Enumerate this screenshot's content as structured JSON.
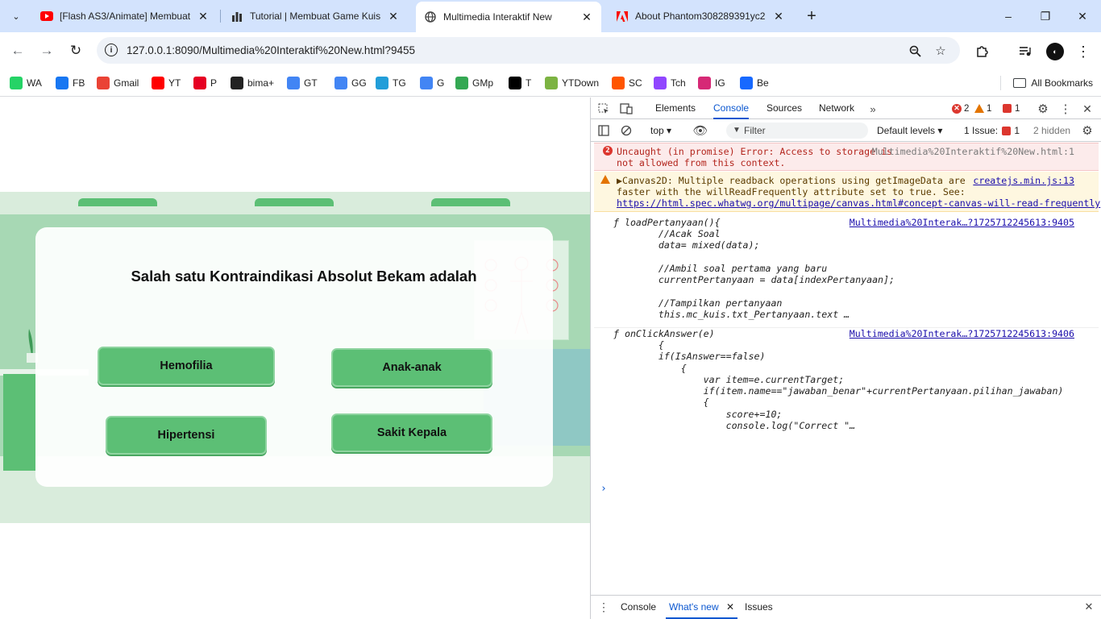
{
  "browser": {
    "tabs": [
      {
        "title": "[Flash AS3/Animate] Membuat",
        "favicon": "youtube-icon",
        "active": false
      },
      {
        "title": "Tutorial | Membuat Game Kuis",
        "favicon": "chart-icon",
        "active": false
      },
      {
        "title": "Multimedia Interaktif New",
        "favicon": "globe-icon",
        "active": true
      },
      {
        "title": "About Phantom308289391yc2",
        "favicon": "adobe-icon",
        "active": false
      }
    ],
    "new_tab": "+",
    "window_controls": [
      "–",
      "❐",
      "✕"
    ],
    "url": "127.0.0.1:8090/Multimedia%20Interaktif%20New.html?9455",
    "bookmarks": [
      {
        "label": "WA",
        "icon": "whatsapp-icon",
        "color": "#25d366"
      },
      {
        "label": "FB",
        "icon": "facebook-icon",
        "color": "#1877f2"
      },
      {
        "label": "Gmail",
        "icon": "gmail-icon",
        "color": "#ea4335"
      },
      {
        "label": "YT",
        "icon": "youtube-icon",
        "color": "#ff0000"
      },
      {
        "label": "P",
        "icon": "pinterest-icon",
        "color": "#e60023"
      },
      {
        "label": "bima+",
        "icon": "bima-icon",
        "color": "#222222"
      },
      {
        "label": "GT",
        "icon": "google-translate-icon",
        "color": "#4285f4"
      },
      {
        "label": "GG",
        "icon": "google-icon",
        "color": "#4285f4"
      },
      {
        "label": "TG",
        "icon": "telegram-icon",
        "color": "#229ed9"
      },
      {
        "label": "G",
        "icon": "google-icon",
        "color": "#4285f4"
      },
      {
        "label": "GMp",
        "icon": "google-maps-icon",
        "color": "#34a853"
      },
      {
        "label": "T",
        "icon": "x-icon",
        "color": "#000000"
      },
      {
        "label": "YTDown",
        "icon": "ytdown-icon",
        "color": "#7cb342"
      },
      {
        "label": "SC",
        "icon": "soundcloud-icon",
        "color": "#ff5500"
      },
      {
        "label": "Tch",
        "icon": "twitch-icon",
        "color": "#9146ff"
      },
      {
        "label": "IG",
        "icon": "instagram-icon",
        "color": "#d62976"
      },
      {
        "label": "Be",
        "icon": "behance-icon",
        "color": "#1769ff"
      }
    ],
    "all_bookmarks": "All Bookmarks"
  },
  "quiz": {
    "question": "Salah satu Kontraindikasi Absolut Bekam adalah",
    "answers": [
      "Hemofilia",
      "Anak-anak",
      "Hipertensi",
      "Sakit Kepala"
    ],
    "accent_color": "#5cbf75"
  },
  "devtools": {
    "tabs": [
      "Elements",
      "Console",
      "Sources",
      "Network"
    ],
    "active_tab": "Console",
    "error_count": "2",
    "warning_count": "1",
    "issue_count": "1",
    "context": "top",
    "filter_placeholder": "Filter",
    "levels": "Default levels",
    "issues_label": "1 Issue:",
    "issues_count": "1",
    "hidden": "2 hidden",
    "messages": {
      "error": {
        "count": "2",
        "line1": "Uncaught (in promise) Error: Access to storage is",
        "line2": "not allowed from this context.",
        "source": "Multimedia%20Interaktif%20New.html:1"
      },
      "warning": {
        "line1": "▶Canvas2D: Multiple readback operations using getImageData are",
        "line2": "faster with the willReadFrequently attribute set to true. See:",
        "link": "https://html.spec.whatwg.org/multipage/canvas.html#concept-canvas-will-read-frequently",
        "source": "createjs.min.js:13"
      },
      "fn1": {
        "head": "ƒ loadPertanyaan(){",
        "source": "Multimedia%20Interak…?1725712245613:9405",
        "body": "        //Acak Soal\n        data= mixed(data);\n\n        //Ambil soal pertama yang baru\n        currentPertanyaan = data[indexPertanyaan];\n\n        //Tampilkan pertanyaan\n        this.mc_kuis.txt_Pertanyaan.text …"
      },
      "fn2": {
        "head": "ƒ onClickAnswer(e)",
        "source": "Multimedia%20Interak…?1725712245613:9406",
        "body": "        {\n        if(IsAnswer==false)\n            {\n                var item=e.currentTarget;\n                if(item.name==\"jawaban_benar\"+currentPertanyaan.pilihan_jawaban)\n                {\n                    score+=10;\n                    console.log(\"Correct \"…"
      }
    },
    "prompt": "›",
    "drawer_tabs": [
      "Console",
      "What's new",
      "Issues"
    ],
    "drawer_active": "What's new"
  }
}
